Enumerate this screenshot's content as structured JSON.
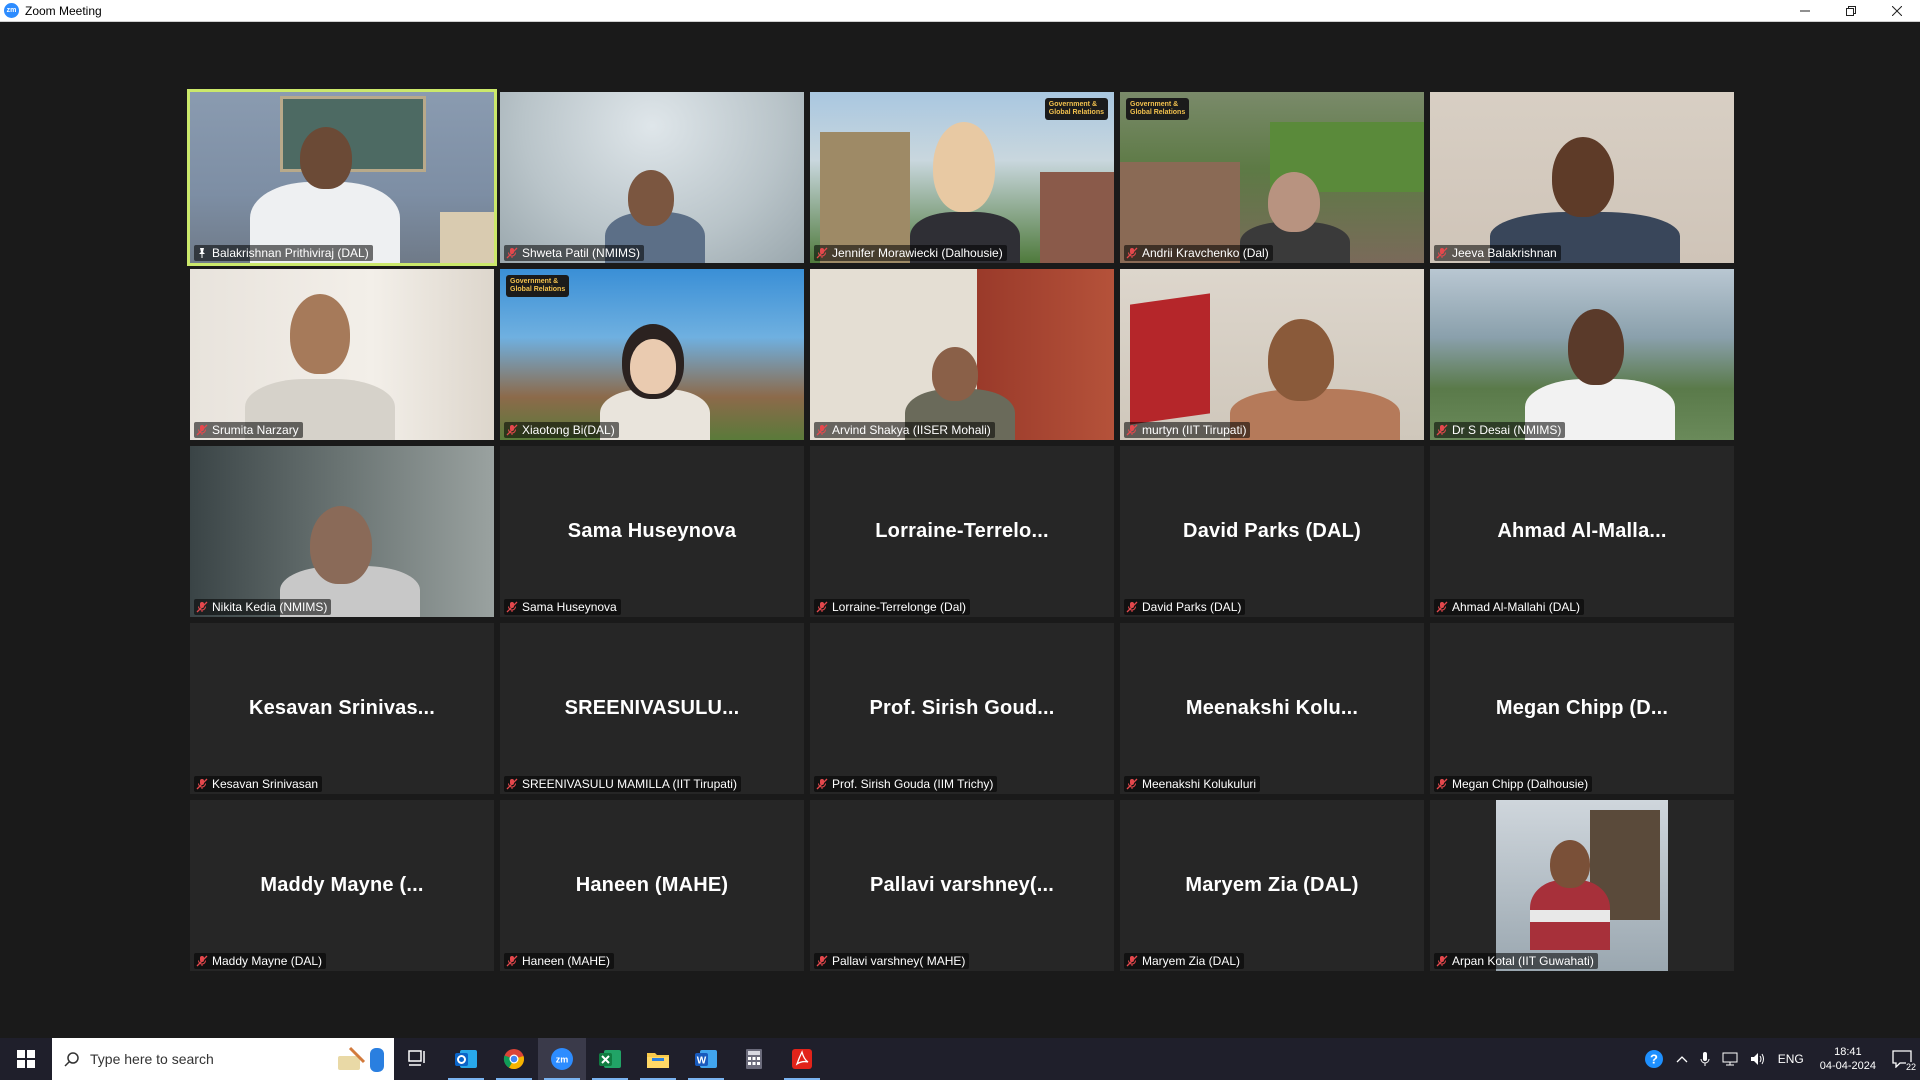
{
  "window": {
    "title": "Zoom Meeting",
    "app_icon_text": "zm"
  },
  "participants": [
    {
      "label": "Balakrishnan Prithiviraj (DAL)",
      "center": "",
      "video": "teacher",
      "active": true
    },
    {
      "label": "Shweta Patil (NMIMS)",
      "center": "",
      "video": "blur"
    },
    {
      "label": "Jennifer Morawiecki (Dalhousie)",
      "center": "",
      "video": "campus-woman"
    },
    {
      "label": "Andrii Kravchenko (Dal)",
      "center": "",
      "video": "campus-man"
    },
    {
      "label": "Jeeva Balakrishnan",
      "center": "",
      "video": "wall-man"
    },
    {
      "label": "Srumita Narzary",
      "center": "",
      "video": "room-woman"
    },
    {
      "label": "Xiaotong Bi(DAL)",
      "center": "",
      "video": "campus-girl"
    },
    {
      "label": "Arvind Shakya (IISER Mohali)",
      "center": "",
      "video": "curtain-man"
    },
    {
      "label": "murtyn (IIT Tirupati)",
      "center": "",
      "video": "flag-man"
    },
    {
      "label": "Dr S Desai (NMIMS)",
      "center": "",
      "video": "aerial-man"
    },
    {
      "label": "Nikita Kedia (NMIMS)",
      "center": "",
      "video": "dark-woman"
    },
    {
      "label": "Sama Huseynova",
      "center": "Sama Huseynova",
      "video": ""
    },
    {
      "label": "Lorraine-Terrelonge (Dal)",
      "center": "Lorraine-Terrelo...",
      "video": ""
    },
    {
      "label": "David Parks (DAL)",
      "center": "David Parks (DAL)",
      "video": ""
    },
    {
      "label": "Ahmad Al-Mallahi (DAL)",
      "center": "Ahmad  Al-Malla...",
      "video": ""
    },
    {
      "label": "Kesavan Srinivasan",
      "center": "Kesavan Srinivas...",
      "video": ""
    },
    {
      "label": "SREENIVASULU MAMILLA (IIT Tirupati)",
      "center": "SREENIVASULU...",
      "video": ""
    },
    {
      "label": "Prof. Sirish Gouda (IIM Trichy)",
      "center": "Prof. Sirish Goud...",
      "video": ""
    },
    {
      "label": "Meenakshi Kolukuluri",
      "center": "Meenakshi  Kolu...",
      "video": ""
    },
    {
      "label": "Megan Chipp (Dalhousie)",
      "center": "Megan Chipp (D...",
      "video": ""
    },
    {
      "label": "Maddy Mayne (DAL)",
      "center": "Maddy Mayne (...",
      "video": ""
    },
    {
      "label": "Haneen (MAHE)",
      "center": "Haneen (MAHE)",
      "video": ""
    },
    {
      "label": "Pallavi varshney( MAHE)",
      "center": "Pallavi  varshney(...",
      "video": ""
    },
    {
      "label": "Maryem Zia (DAL)",
      "center": "Maryem Zia (DAL)",
      "video": ""
    },
    {
      "label": "Arpan Kotal (IIT Guwahati)",
      "center": "",
      "video": "photo-man"
    }
  ],
  "banner_text": "Government & Global Relations",
  "taskbar": {
    "search_placeholder": "Type here to search",
    "apps": [
      "task-view",
      "outlook",
      "chrome",
      "zoom",
      "excel",
      "file-explorer",
      "word",
      "calculator",
      "acrobat"
    ],
    "language": "ENG",
    "time": "18:41",
    "date": "04-04-2024",
    "notification_count": "22"
  },
  "colors": {
    "active_speaker": "#cbe86b",
    "muted_mic": "#e5484d",
    "zoom_blue": "#2d8cff"
  }
}
